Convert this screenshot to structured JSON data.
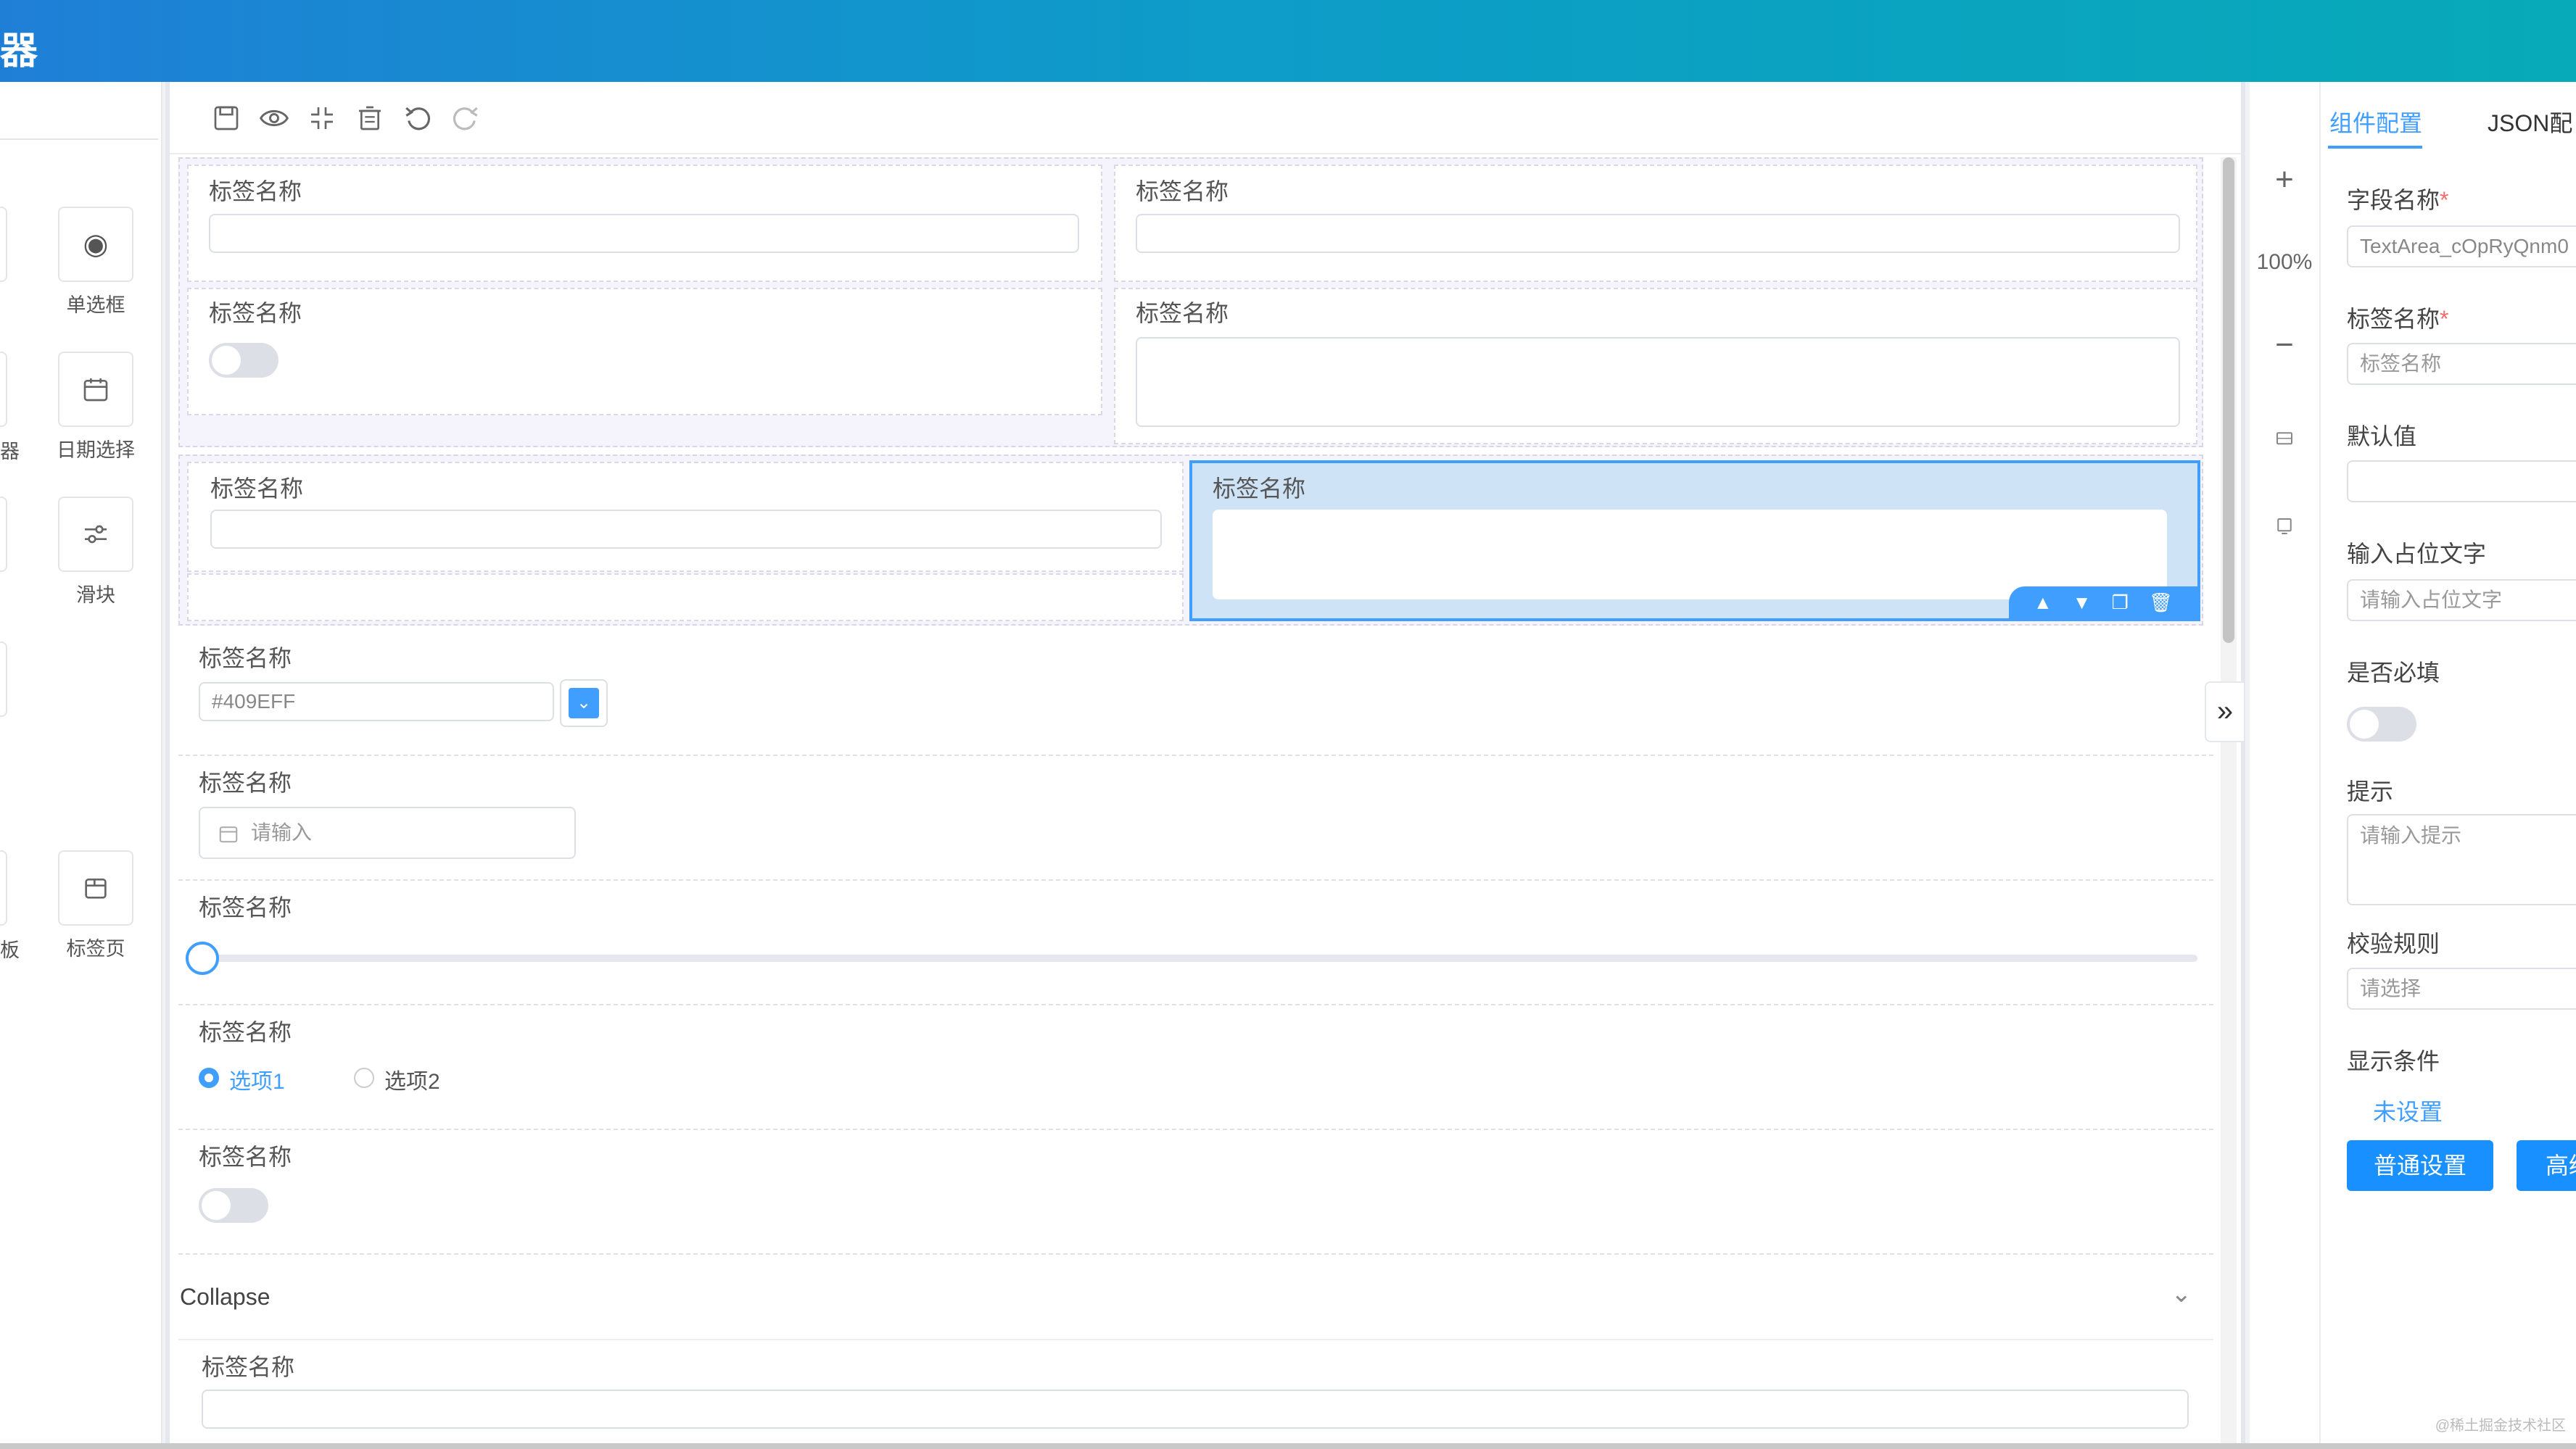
{
  "header": {
    "app_title": "器"
  },
  "left_panel": {
    "items": [
      {
        "label": "单选框",
        "icon": "radio-icon"
      },
      {
        "label": "日期选择",
        "icon": "calendar-icon"
      },
      {
        "label": "滑块",
        "icon": "slider-icon"
      },
      {
        "label": "标签页",
        "icon": "tabs-icon"
      }
    ],
    "partial_labels": [
      "器",
      "板"
    ]
  },
  "toolbar": {
    "icons": [
      "save-icon",
      "preview-icon",
      "fullscreen-icon",
      "clear-icon",
      "undo-icon",
      "redo-icon"
    ]
  },
  "form": {
    "label": "标签名称",
    "color_value": "#409EFF",
    "date_placeholder": "请输入",
    "radio_options": [
      "选项1",
      "选项2"
    ],
    "collapse_title": "Collapse"
  },
  "zoom": {
    "level": "100%",
    "plus": "+",
    "minus": "−"
  },
  "right_panel": {
    "tabs": [
      "组件配置",
      "JSON配"
    ],
    "field_name_label": "字段名称",
    "field_name_value": "TextArea_cOpRyQnm0",
    "label_name_label": "标签名称",
    "label_name_value": "标签名称",
    "default_label": "默认值",
    "placeholder_label": "输入占位文字",
    "placeholder_hint": "请输入占位文字",
    "required_label": "是否必填",
    "hint_label": "提示",
    "hint_placeholder": "请输入提示",
    "rules_label": "校验规则",
    "rules_placeholder": "请选择",
    "condition_label": "显示条件",
    "condition_link": "未设置",
    "normal_settings": "普通设置",
    "advanced_settings": "高级",
    "asterisk": "*"
  },
  "watermark": "@稀土掘金技术社区",
  "colors": {
    "accent": "#409eff",
    "header_start": "#1f7fd6",
    "header_end": "#07aab8"
  }
}
